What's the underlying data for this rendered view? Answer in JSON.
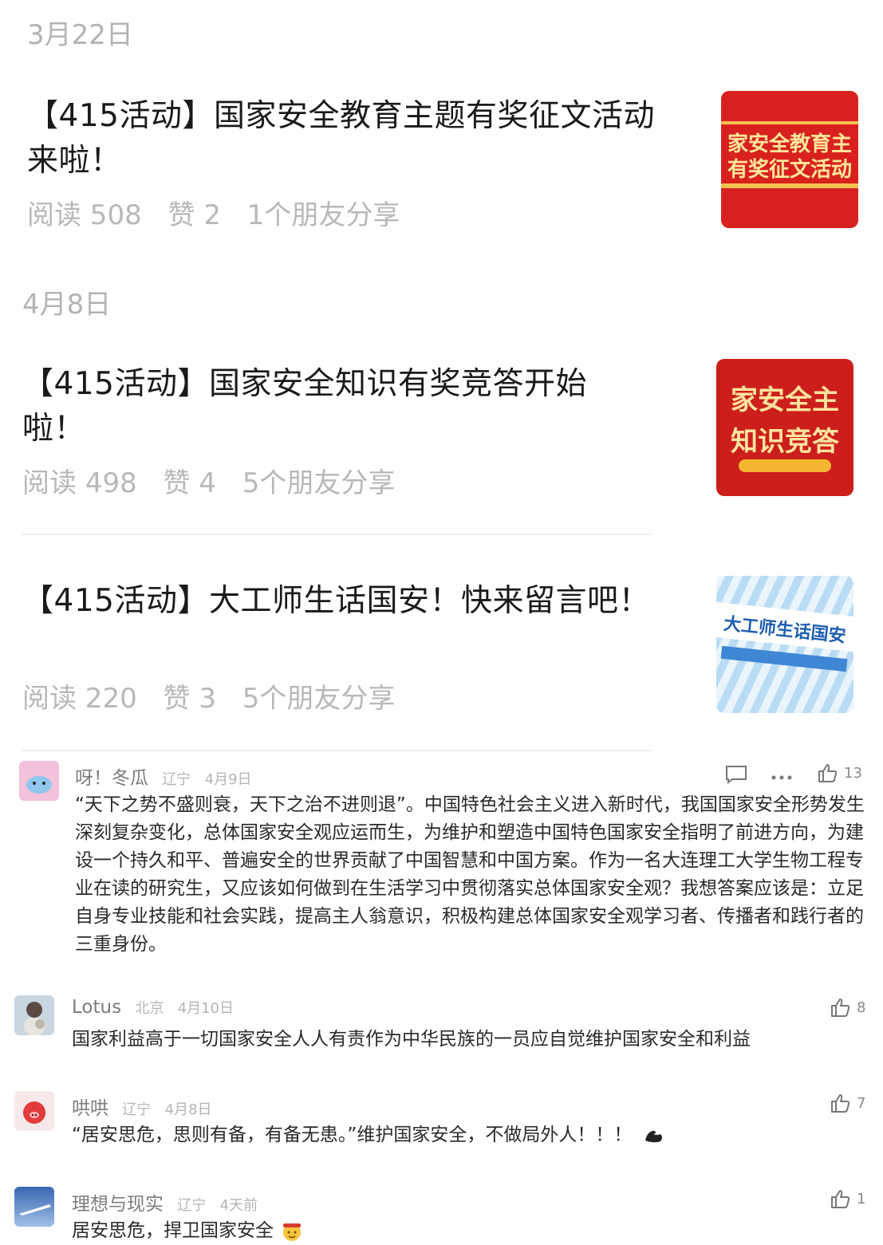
{
  "articles": [
    {
      "date": "3月22日",
      "title": "【415活动】国家安全教育主题有奖征文活动来啦！",
      "reads": "阅读 508",
      "likes": "赞 2",
      "shares": "1个朋友分享",
      "thumb": {
        "line1": "家安全教育主",
        "line2": "有奖征文活动",
        "bg": "#d8211e"
      }
    },
    {
      "date": "4月8日",
      "title": "【415活动】国家安全知识有奖竞答开始啦！",
      "reads": "阅读 498",
      "likes": "赞 4",
      "shares": "5个朋友分享",
      "thumb": {
        "line1": "家安全主",
        "line2": "知识竞答",
        "bg": "#cc1f1b"
      }
    },
    {
      "date": "",
      "title": "【415活动】大工师生话国安！快来留言吧！",
      "reads": "阅读 220",
      "likes": "赞 3",
      "shares": "5个朋友分享",
      "thumb": {
        "line1": "大工师生话国安",
        "line2": "",
        "bg": "#dcecf8"
      }
    }
  ],
  "comments": [
    {
      "name": "呀！冬瓜",
      "location": "辽宁",
      "date": "4月9日",
      "likes": "13",
      "text": "“天下之势不盛则衰，天下之治不进则退”。中国特色社会主义进入新时代，我国国家安全形势发生深刻复杂变化，总体国家安全观应运而生，为维护和塑造中国特色国家安全指明了前进方向，为建设一个持久和平、普遍安全的世界贡献了中国智慧和中国方案。作为一名大连理工大学生物工程专业在读的研究生，又应该如何做到在生活学习中贯彻落实总体国家安全观？我想答案应该是：立足自身专业技能和社会实践，提高主人翁意识，积极构建总体国家安全观学习者、传播者和践行者的三重身份。",
      "avatar_color": "#f3c1d9"
    },
    {
      "name": "Lotus",
      "location": "北京",
      "date": "4月10日",
      "likes": "8",
      "text": "国家利益高于一切国家安全人人有责作为中华民族的一员应自觉维护国家安全和利益",
      "avatar_color": "#9fb7c9"
    },
    {
      "name": "哄哄",
      "location": "辽宁",
      "date": "4月8日",
      "likes": "7",
      "text": "“居安思危，思则有备，有备无患。”维护国家安全，不做局外人！！！",
      "avatar_color": "#f4d6d6"
    },
    {
      "name": "理想与现实",
      "location": "辽宁",
      "date": "4天前",
      "likes": "1",
      "text": "居安思危，捍卫国家安全",
      "avatar_color": "#6b8fc4"
    }
  ]
}
